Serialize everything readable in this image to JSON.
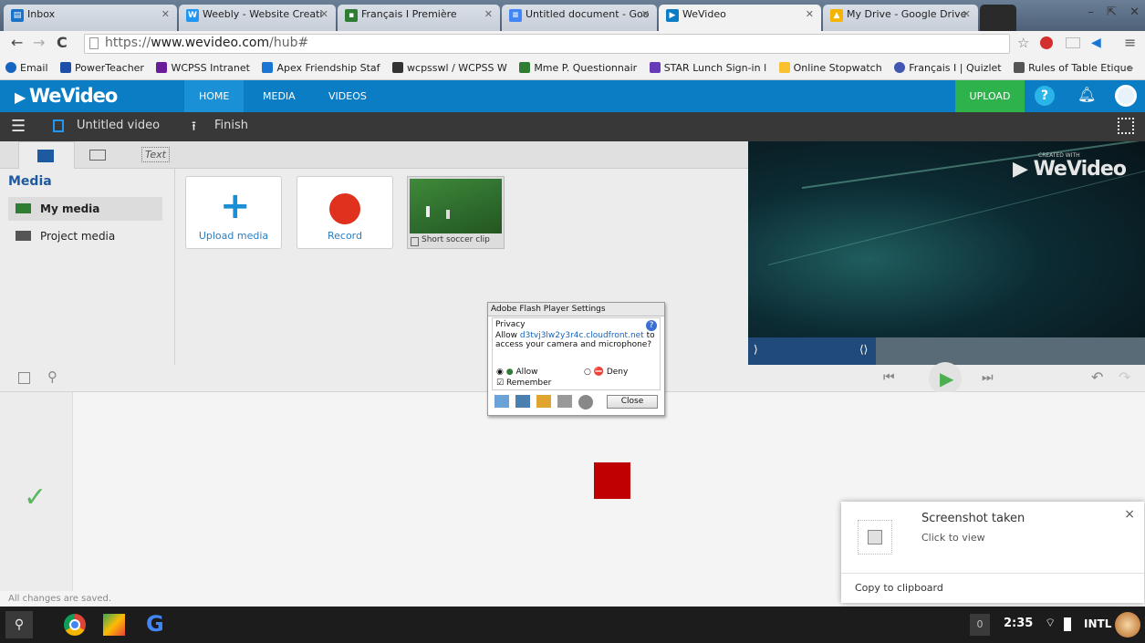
{
  "browser": {
    "tabs": [
      {
        "label": "Inbox",
        "icon": "inbox-icon",
        "color": "#1a73c8"
      },
      {
        "label": "Weebly - Website Creati",
        "icon": "weebly-icon",
        "color": "#2196f3"
      },
      {
        "label": "Français I Première",
        "icon": "classroom-icon",
        "color": "#2e7d32"
      },
      {
        "label": "Untitled document - Goo",
        "icon": "docs-icon",
        "color": "#4285f4"
      },
      {
        "label": "WeVideo",
        "icon": "wevideo-icon",
        "color": "#0a7dc5"
      },
      {
        "label": "My Drive - Google Drive",
        "icon": "drive-icon",
        "color": "#f4b400"
      }
    ],
    "url_prefix": "https://",
    "url_domain": "www.wevideo.com",
    "url_path": "/hub#",
    "bookmarks": [
      {
        "label": "Email"
      },
      {
        "label": "PowerTeacher"
      },
      {
        "label": "WCPSS Intranet"
      },
      {
        "label": "Apex Friendship Staf"
      },
      {
        "label": "wcpsswl / WCPSS W"
      },
      {
        "label": "Mme P. Questionnair"
      },
      {
        "label": "STAR Lunch Sign-in l"
      },
      {
        "label": "Online Stopwatch"
      },
      {
        "label": "Français I | Quizlet"
      },
      {
        "label": "Rules of Table Etique"
      }
    ],
    "overflow": "»"
  },
  "app": {
    "logo": "WeVideo",
    "nav": [
      "HOME",
      "MEDIA",
      "VIDEOS"
    ],
    "upload": "UPLOAD",
    "help": "?",
    "project_title": "Untitled video",
    "finish": "Finish"
  },
  "media": {
    "heading": "Media",
    "tab_text": "Text",
    "folders": [
      "My media",
      "Project media"
    ],
    "cards": [
      "Upload media",
      "Record"
    ],
    "clip_label": "Short soccer clip"
  },
  "preview": {
    "watermark_small": "CREATED WITH",
    "watermark": "WeVideo"
  },
  "flash": {
    "title": "Adobe Flash Player Settings",
    "section": "Privacy",
    "text_pre": "Allow",
    "domain": "d3tvj3lw2y3r4c.cloudfront.net",
    "text_post": "to access your camera and microphone?",
    "allow": "Allow",
    "deny": "Deny",
    "remember": "Remember",
    "close": "Close"
  },
  "status": "All changes are saved.",
  "notification": {
    "title": "Screenshot taken",
    "subtitle": "Click to view",
    "action": "Copy to clipboard",
    "close": "×"
  },
  "shelf": {
    "badge": "0",
    "time": "2:35",
    "ime": "INTL"
  }
}
